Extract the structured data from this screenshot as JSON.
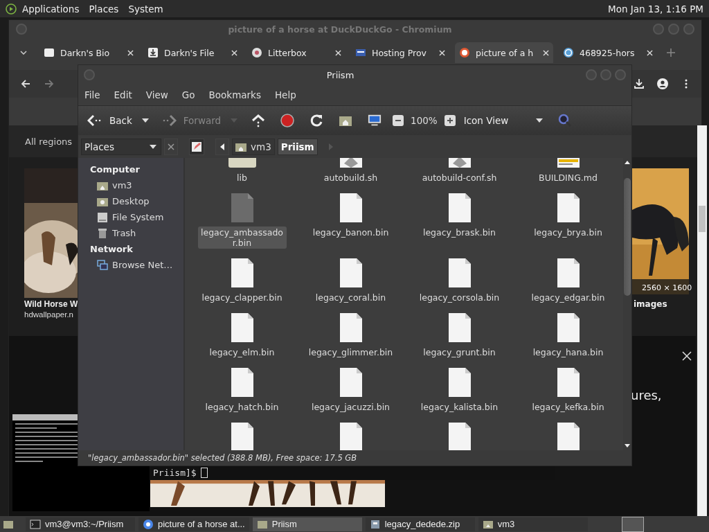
{
  "top_panel": {
    "menus": [
      "Applications",
      "Places",
      "System"
    ],
    "clock": "Mon Jan 13, 1:16 PM"
  },
  "browser": {
    "title": "picture of a horse at DuckDuckGo - Chromium",
    "tabs": [
      {
        "label": "Darkn's Bio",
        "kind": "badge",
        "selected": false
      },
      {
        "label": "Darkn's File",
        "kind": "download",
        "selected": false
      },
      {
        "label": "Litterbox",
        "kind": "cat",
        "selected": false
      },
      {
        "label": "Hosting Prov",
        "kind": "host",
        "selected": false
      },
      {
        "label": "picture of a h",
        "kind": "duck",
        "selected": true
      },
      {
        "label": "468925-hors",
        "kind": "wp",
        "selected": false
      }
    ],
    "page": {
      "filter": "All regions",
      "result_title": "Wild Horse W",
      "result_source": "hdwallpaper.n",
      "image_size": "2560 × 1600",
      "result_source_2": "images",
      "banner_text": "ures,"
    }
  },
  "terminal": {
    "prompt": "Priism]$"
  },
  "file_manager": {
    "title": "Priism",
    "menu": [
      "File",
      "Edit",
      "View",
      "Go",
      "Bookmarks",
      "Help"
    ],
    "nav_buttons": [
      {
        "kind": "back",
        "label": "Back",
        "disabled": false
      },
      {
        "kind": "forward",
        "label": "Forward",
        "disabled": true
      }
    ],
    "zoom": "100%",
    "view": "Icon View",
    "places_label": "Places",
    "sidebar": [
      {
        "heading": "Computer",
        "items": [
          {
            "label": "vm3",
            "kind": "home"
          },
          {
            "label": "Desktop",
            "kind": "desktop"
          },
          {
            "label": "File System",
            "kind": "drive"
          },
          {
            "label": "Trash",
            "kind": "trash"
          }
        ]
      },
      {
        "heading": "Network",
        "items": [
          {
            "label": "Browse Net…",
            "kind": "network"
          }
        ]
      }
    ],
    "path": [
      {
        "label": "vm3",
        "selected": false
      },
      {
        "label": "Priism",
        "selected": true
      }
    ],
    "files": [
      {
        "name": "lib",
        "kind": "folder",
        "selected": false
      },
      {
        "name": "autobuild.sh",
        "kind": "script",
        "selected": false
      },
      {
        "name": "autobuild-conf.sh",
        "kind": "script",
        "selected": false
      },
      {
        "name": "BUILDING.md",
        "kind": "document",
        "selected": false
      },
      {
        "name": "legacy_ambassador.bin",
        "kind": "binary",
        "selected": true
      },
      {
        "name": "legacy_banon.bin",
        "kind": "binary",
        "selected": false
      },
      {
        "name": "legacy_brask.bin",
        "kind": "binary",
        "selected": false
      },
      {
        "name": "legacy_brya.bin",
        "kind": "binary",
        "selected": false
      },
      {
        "name": "legacy_clapper.bin",
        "kind": "binary",
        "selected": false
      },
      {
        "name": "legacy_coral.bin",
        "kind": "binary",
        "selected": false
      },
      {
        "name": "legacy_corsola.bin",
        "kind": "binary",
        "selected": false
      },
      {
        "name": "legacy_edgar.bin",
        "kind": "binary",
        "selected": false
      },
      {
        "name": "legacy_elm.bin",
        "kind": "binary",
        "selected": false
      },
      {
        "name": "legacy_glimmer.bin",
        "kind": "binary",
        "selected": false
      },
      {
        "name": "legacy_grunt.bin",
        "kind": "binary",
        "selected": false
      },
      {
        "name": "legacy_hana.bin",
        "kind": "binary",
        "selected": false
      },
      {
        "name": "legacy_hatch.bin",
        "kind": "binary",
        "selected": false
      },
      {
        "name": "legacy_jacuzzi.bin",
        "kind": "binary",
        "selected": false
      },
      {
        "name": "legacy_kalista.bin",
        "kind": "binary",
        "selected": false
      },
      {
        "name": "legacy_kefka.bin",
        "kind": "binary",
        "selected": false
      },
      {
        "kind": "binary",
        "selected": false
      },
      {
        "kind": "binary",
        "selected": false
      },
      {
        "kind": "binary",
        "selected": false
      },
      {
        "kind": "binary",
        "selected": false
      }
    ],
    "status": "\"legacy_ambassador.bin\" selected (388.8 MB), Free space: 17.5 GB"
  },
  "taskbar": [
    {
      "label": "vm3@vm3:~/Priism",
      "kind": "terminal",
      "selected": false
    },
    {
      "label": "picture of a horse at...",
      "kind": "browser",
      "selected": false
    },
    {
      "label": "Priism",
      "kind": "folder",
      "selected": true
    },
    {
      "label": "legacy_dedede.zip",
      "kind": "archive",
      "selected": false
    },
    {
      "label": "vm3",
      "kind": "home",
      "selected": false
    }
  ]
}
